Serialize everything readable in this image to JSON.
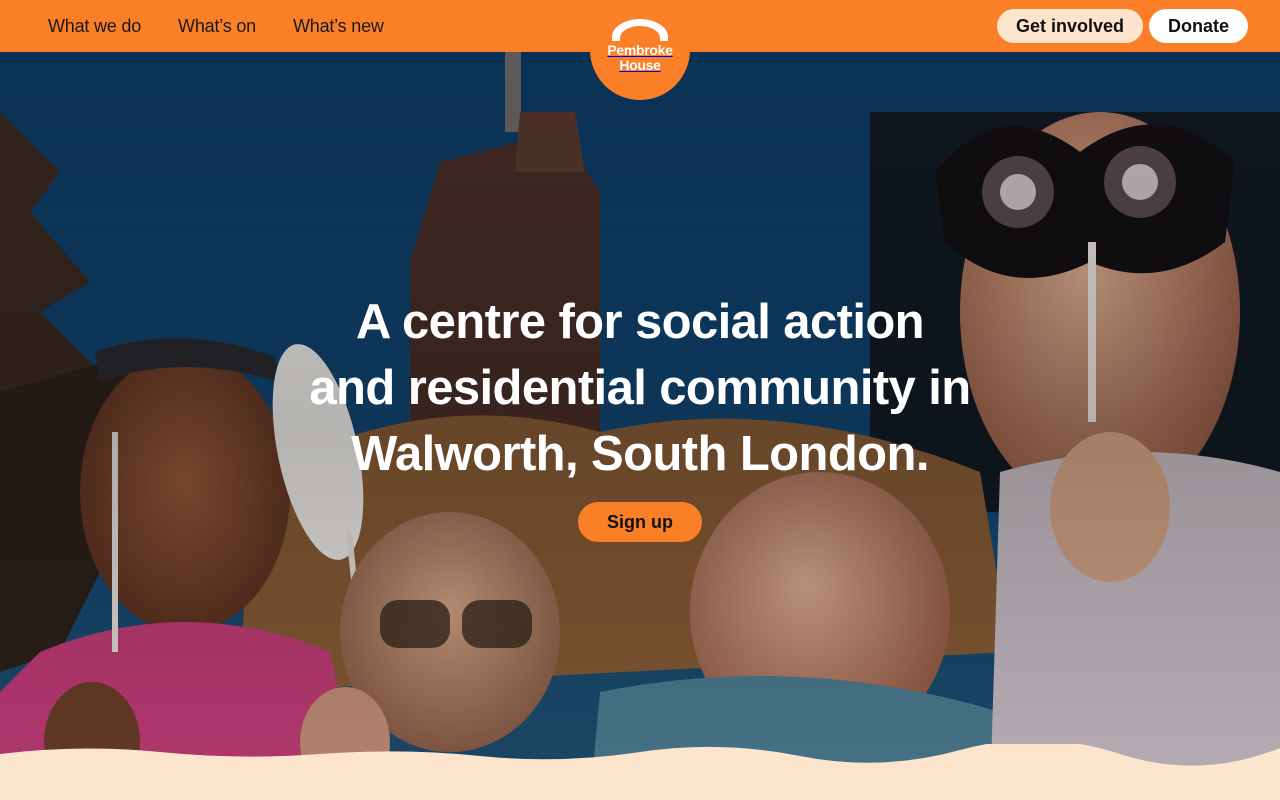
{
  "nav": {
    "items": [
      {
        "label": "What we do"
      },
      {
        "label": "What’s on"
      },
      {
        "label": "What’s new"
      }
    ]
  },
  "logo": {
    "line1": "Pembroke",
    "line2": "House"
  },
  "header_actions": {
    "get_involved": "Get involved",
    "donate": "Donate"
  },
  "hero": {
    "headline_lines": [
      "A centre for social action",
      "and residential community in",
      "Walworth, South London."
    ],
    "cta": "Sign up"
  },
  "colors": {
    "brand_orange": "#fb7f26",
    "cream": "#fde4cc",
    "white": "#ffffff"
  }
}
